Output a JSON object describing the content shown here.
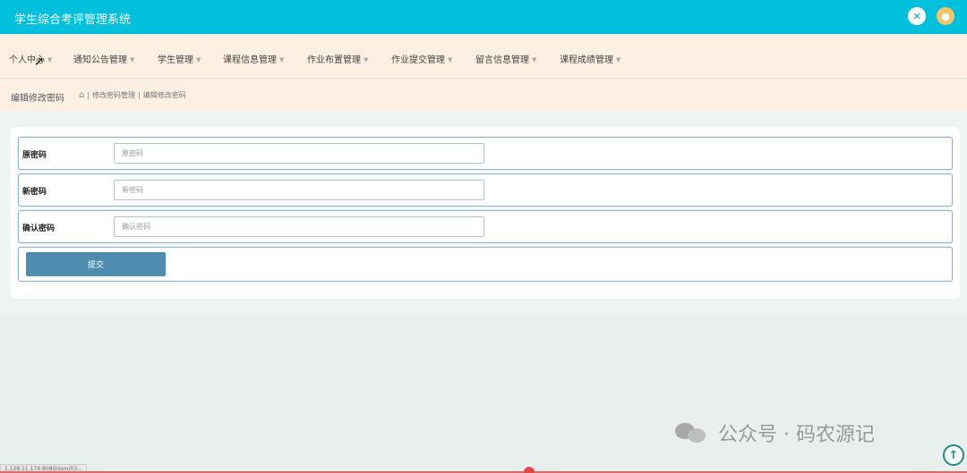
{
  "app": {
    "title": "学生综合考评管理系统"
  },
  "header_icons": {
    "fullscreen": "fullscreen-icon",
    "user": "user-avatar-icon"
  },
  "nav": {
    "items": [
      {
        "label": "个人中心"
      },
      {
        "label": "通知公告管理"
      },
      {
        "label": "学生管理"
      },
      {
        "label": "课程信息管理"
      },
      {
        "label": "作业布置管理"
      },
      {
        "label": "作业提交管理"
      },
      {
        "label": "留言信息管理"
      },
      {
        "label": "课程成绩管理"
      }
    ]
  },
  "page": {
    "title": "编辑修改密码",
    "breadcrumb": [
      "修改密码管理",
      "编辑修改密码"
    ]
  },
  "form": {
    "fields": [
      {
        "label": "原密码",
        "placeholder": "原密码",
        "value": ""
      },
      {
        "label": "新密码",
        "placeholder": "新密码",
        "value": ""
      },
      {
        "label": "确认密码",
        "placeholder": "确认密码",
        "value": ""
      }
    ],
    "submit_label": "提交"
  },
  "watermark": {
    "text": "公众号 · 码农源记"
  },
  "status_bar": {
    "url": "1.128.11.174:8080/ssm/03..."
  },
  "colors": {
    "header": "#00c0dc",
    "nav_background": "#fdf0e3",
    "submit_button": "#4e8daf",
    "row_border": "#8fb2d2"
  }
}
